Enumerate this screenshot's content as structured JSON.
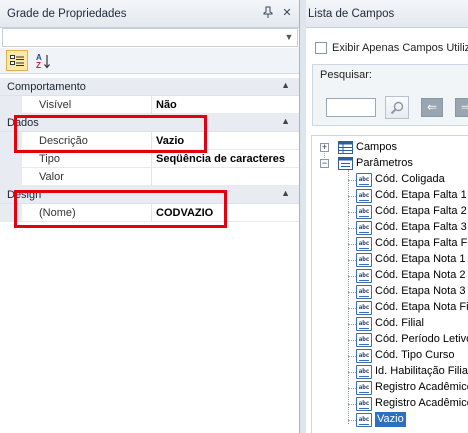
{
  "property_grid": {
    "title": "Grade de Propriedades",
    "pin_icon": "pin-icon",
    "close_icon": "close-icon",
    "selector_value": "",
    "toolbar": {
      "categorized_icon": "categorized-view-icon",
      "alphabetical_icon": "sort-az-icon",
      "alphabetical_glyph": "A Z"
    },
    "categories": [
      {
        "name": "Comportamento",
        "properties": [
          {
            "name": "Visível",
            "value": "Não"
          }
        ]
      },
      {
        "name": "Dados",
        "properties": [
          {
            "name": "Descrição",
            "value": "Vazio"
          },
          {
            "name": "Tipo",
            "value": "Seqüência de caracteres"
          },
          {
            "name": "Valor",
            "value": ""
          }
        ]
      },
      {
        "name": "Design",
        "properties": [
          {
            "name": "(Nome)",
            "value": "CODVAZIO"
          }
        ]
      }
    ],
    "highlight_color": "#e3000f"
  },
  "fields_list": {
    "title": "Lista de Campos",
    "show_only_fields_label": "Exibir Apenas Campos Utilizados",
    "show_only_fields_checked": false,
    "search_label": "Pesquisar:",
    "search_value": "",
    "tree": {
      "campos_label": "Campos",
      "parametros_label": "Parâmetros",
      "items": [
        "Cód. Coligada",
        "Cód. Etapa Falta 1",
        "Cód. Etapa Falta 2",
        "Cód. Etapa Falta 3",
        "Cód. Etapa Falta Final",
        "Cód. Etapa Nota 1",
        "Cód. Etapa Nota 2",
        "Cód. Etapa Nota 3",
        "Cód. Etapa Nota Final",
        "Cód. Filial",
        "Cód. Período Letivo",
        "Cód. Tipo Curso",
        "Id. Habilitação Filial",
        "Registro Acadêmico",
        "Registro Acadêmico",
        "Vazio"
      ],
      "selected_item": "Vazio",
      "selection_color": "#2f6fc0"
    }
  }
}
